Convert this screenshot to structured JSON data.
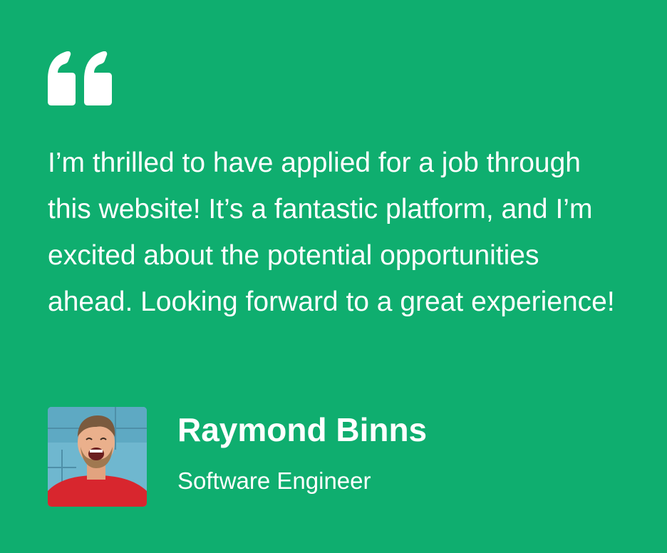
{
  "testimonial": {
    "quote_icon": "quote-open-icon",
    "text": "I’m thrilled to have applied for a job through this website! It’s a fantastic platform, and I’m excited about the potential opportunities ahead. Looking forward to a great experience!",
    "author": {
      "name": "Raymond Binns",
      "role": "Software Engineer",
      "avatar_icon": "person-photo"
    }
  },
  "colors": {
    "background": "#0fae6f",
    "text": "#ffffff"
  }
}
